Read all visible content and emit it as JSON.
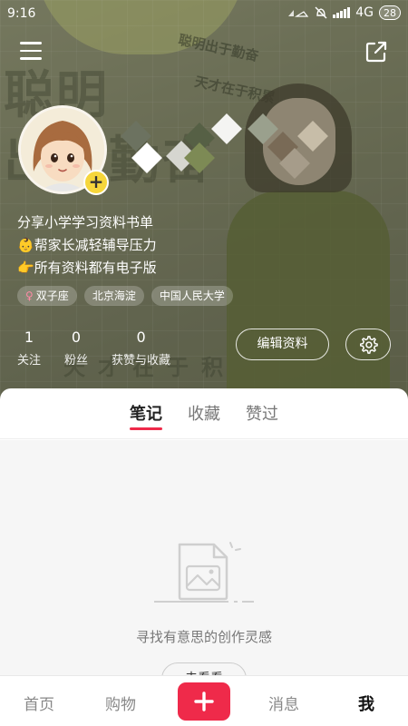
{
  "status_bar": {
    "time": "9:16",
    "network": "4G",
    "battery": "28"
  },
  "header": {
    "menu_icon": "hamburger-menu-icon",
    "share_icon": "share-export-icon"
  },
  "cover": {
    "bg_text_large": [
      "聪",
      "明",
      "出",
      "于",
      "勤",
      "奋"
    ],
    "bg_text_badge_top": "聪明出于勤奋",
    "bg_text_badge_bottom": "天才在于积累",
    "bg_text_bottom": "天才在于积"
  },
  "profile": {
    "avatar_add_label": "+",
    "bio_lines": [
      "分享小学学习资料书单",
      "👶帮家长减轻辅导压力",
      "👉所有资料都有电子版"
    ],
    "tags": [
      "双子座",
      "北京海淀",
      "中国人民大学"
    ],
    "gender_symbol": "♀",
    "stats": [
      {
        "value": "1",
        "label": "关注"
      },
      {
        "value": "0",
        "label": "粉丝"
      },
      {
        "value": "0",
        "label": "获赞与收藏"
      }
    ],
    "edit_label": "编辑资料",
    "settings_icon": "gear-icon"
  },
  "tabs": {
    "items": [
      "笔记",
      "收藏",
      "赞过"
    ],
    "active_index": 0
  },
  "empty_state": {
    "icon": "image-document-icon",
    "message": "寻找有意思的创作灵感",
    "button_label": "去看看"
  },
  "bottom_nav": {
    "home": "首页",
    "shop": "购物",
    "publish_icon": "plus-icon",
    "messages": "消息",
    "me": "我"
  },
  "colors": {
    "accent": "#ef2a4a",
    "cover_bg": "#7c7f63",
    "avatar_badge": "#f6d63b"
  }
}
